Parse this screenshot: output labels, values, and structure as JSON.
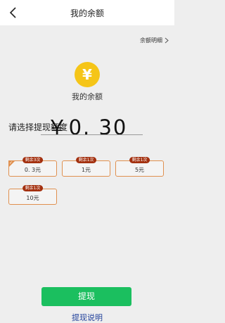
{
  "header": {
    "title": "我的余额"
  },
  "detail_link": "余额明细",
  "balance": {
    "currency_symbol": "¥",
    "label": "我的余额",
    "amount": "￥0. 30"
  },
  "choose_label": "请选择提现额度",
  "options": [
    {
      "badge": "剩余3次",
      "value": "0. 3元",
      "selected": true
    },
    {
      "badge": "剩余1次",
      "value": "1元",
      "selected": false
    },
    {
      "badge": "剩余1次",
      "value": "5元",
      "selected": false
    },
    {
      "badge": "剩余1次",
      "value": "10元",
      "selected": false
    }
  ],
  "actions": {
    "withdraw": "提现",
    "help": "提现说明"
  },
  "colors": {
    "accent_green": "#1bbf5f",
    "coin_yellow": "#f5c518",
    "option_border": "#e0904f",
    "badge_bg": "#a3300f",
    "link_blue": "#1f3f9a"
  }
}
